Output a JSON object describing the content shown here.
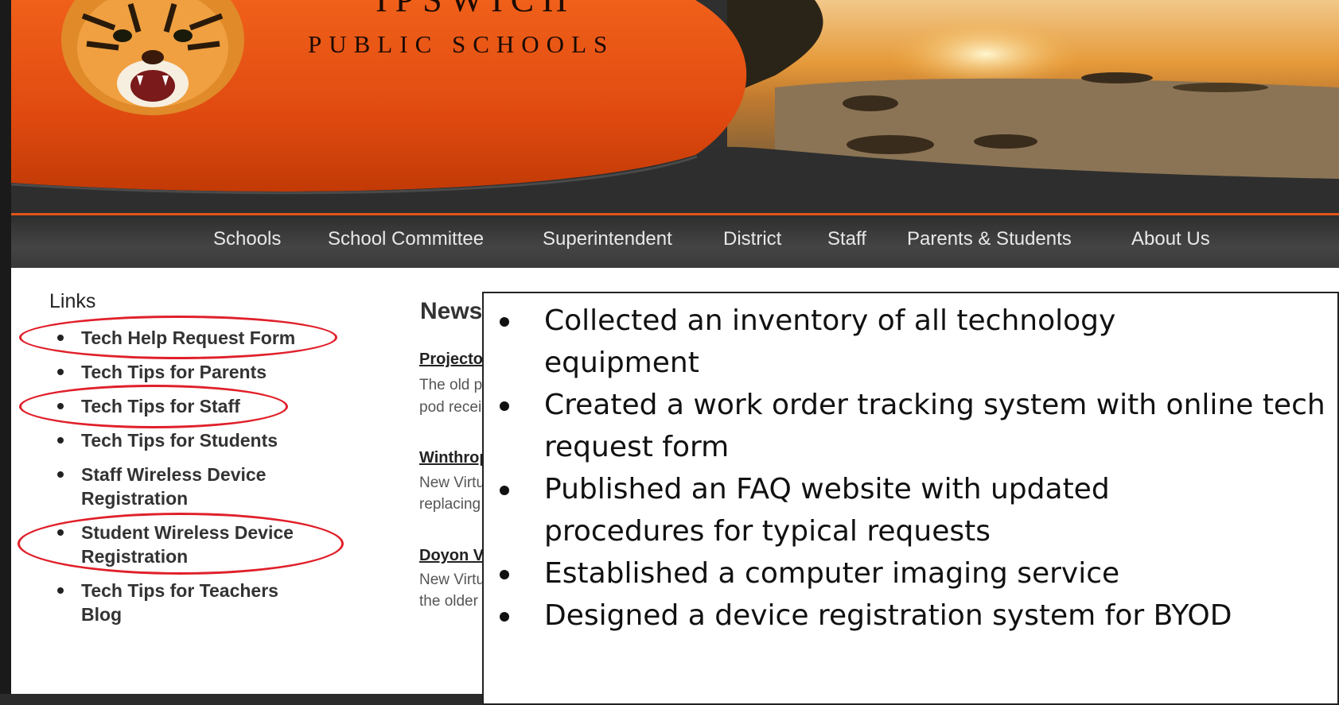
{
  "header": {
    "logo_top": "IPSWICH",
    "logo_text": "PUBLIC SCHOOLS"
  },
  "nav": {
    "items": [
      "Schools",
      "School Committee",
      "Superintendent",
      "District",
      "Staff",
      "Parents & Students",
      "About Us"
    ]
  },
  "sidebar": {
    "title": "Links",
    "items": [
      {
        "label": "Tech Help Request Form",
        "highlighted": true
      },
      {
        "label": "Tech Tips for Parents",
        "highlighted": false
      },
      {
        "label": "Tech Tips for Staff",
        "highlighted": true
      },
      {
        "label": "Tech Tips for Students",
        "highlighted": false
      },
      {
        "label": "Staff Wireless Device Registration",
        "highlighted": false
      },
      {
        "label": "Student Wireless Device Registration",
        "highlighted": true
      },
      {
        "label": "Tech Tips for Teachers Blog",
        "highlighted": false
      }
    ]
  },
  "news": {
    "title": "News",
    "items": [
      {
        "headline": "Projector",
        "line1": "The old p",
        "line2": "pod recei"
      },
      {
        "headline": "Winthrop",
        "line1": "New Virtu",
        "line2": "replacing"
      },
      {
        "headline": "Doyon Vi",
        "line1": "New Virtu",
        "line2": "the older"
      }
    ]
  },
  "overlay": {
    "bullets": [
      "Collected an inventory of all technology equipment",
      "Created a work order tracking system with online tech request form",
      "Published an FAQ website with updated procedures for typical requests",
      "Established a computer imaging service",
      "Designed a device registration system for BYOD"
    ]
  },
  "colors": {
    "brand_orange": "#e0551a",
    "highlight_red": "#e0202a",
    "nav_dark": "#3a3a3a"
  }
}
